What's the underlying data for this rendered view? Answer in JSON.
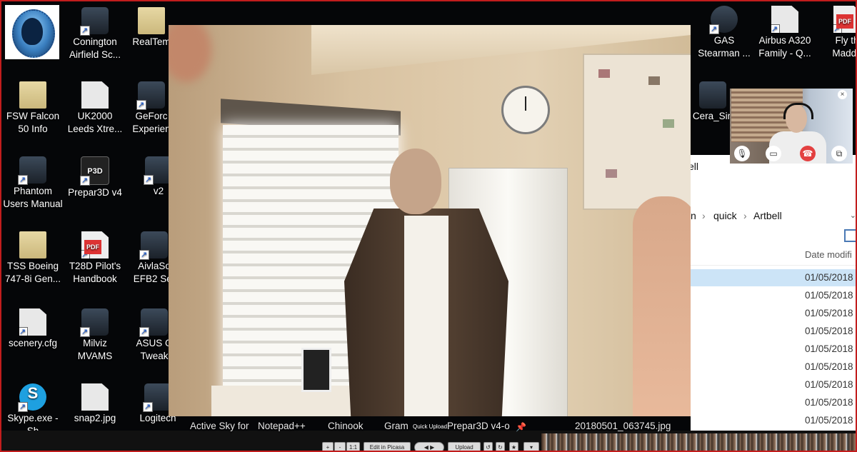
{
  "desktop": {
    "border_color": "#c21d1d",
    "icons": [
      {
        "label": "Conington\nAirfield Sc...",
        "type": "app"
      },
      {
        "label": "RealTem",
        "type": "folder"
      },
      {
        "label": "FSW Falcon\n50 Info",
        "type": "folder"
      },
      {
        "label": "UK2000\nLeeds Xtre...",
        "type": "file"
      },
      {
        "label": "GeForc\nExperien",
        "type": "app"
      },
      {
        "label": "Phantom\nUsers Manual",
        "type": "app"
      },
      {
        "label": "Prepar3D v4",
        "type": "p3d"
      },
      {
        "label": "v2",
        "type": "app"
      },
      {
        "label": "TSS Boeing\n747-8i Gen...",
        "type": "folder"
      },
      {
        "label": "T28D Pilot's\nHandbook",
        "type": "pdf"
      },
      {
        "label": "AivlaSo\nEFB2 Ser",
        "type": "app"
      },
      {
        "label": "scenery.cfg",
        "type": "file"
      },
      {
        "label": "Milviz\nMVAMS",
        "type": "app"
      },
      {
        "label": "ASUS G\nTweak",
        "type": "app"
      },
      {
        "label": "Skype.exe -\nSh",
        "type": "skype"
      },
      {
        "label": "snap2.jpg",
        "type": "file"
      },
      {
        "label": "Logitech",
        "type": "app"
      },
      {
        "label": "GAS\nStearman ...",
        "type": "app"
      },
      {
        "label": "Airbus A320\nFamily - Q...",
        "type": "file"
      },
      {
        "label": "Fly th\nMaddo",
        "type": "pdf"
      },
      {
        "label": "Cera_Sin",
        "type": "app"
      }
    ]
  },
  "explorer": {
    "title_fragment": "ell",
    "breadcrumb": [
      "n",
      "quick",
      "Artbell"
    ],
    "column_header": "Date modifi",
    "rows": [
      "01/05/2018",
      "01/05/2018",
      "01/05/2018",
      "01/05/2018",
      "01/05/2018",
      "01/05/2018",
      "01/05/2018",
      "01/05/2018",
      "01/05/2018"
    ],
    "selected_row": 0
  },
  "call": {
    "end_color": "#e34040"
  },
  "taskbar": {
    "labels": [
      "Active Sky for",
      "Notepad++",
      "Chinook",
      "Gram",
      "Prepar3D v4-o",
      "20180501_063745.jpg"
    ],
    "quick_upload": "Quick Upload",
    "picasa_buttons": [
      "+",
      "-",
      "1:1",
      "Edit in Picasa",
      "Upload"
    ]
  }
}
